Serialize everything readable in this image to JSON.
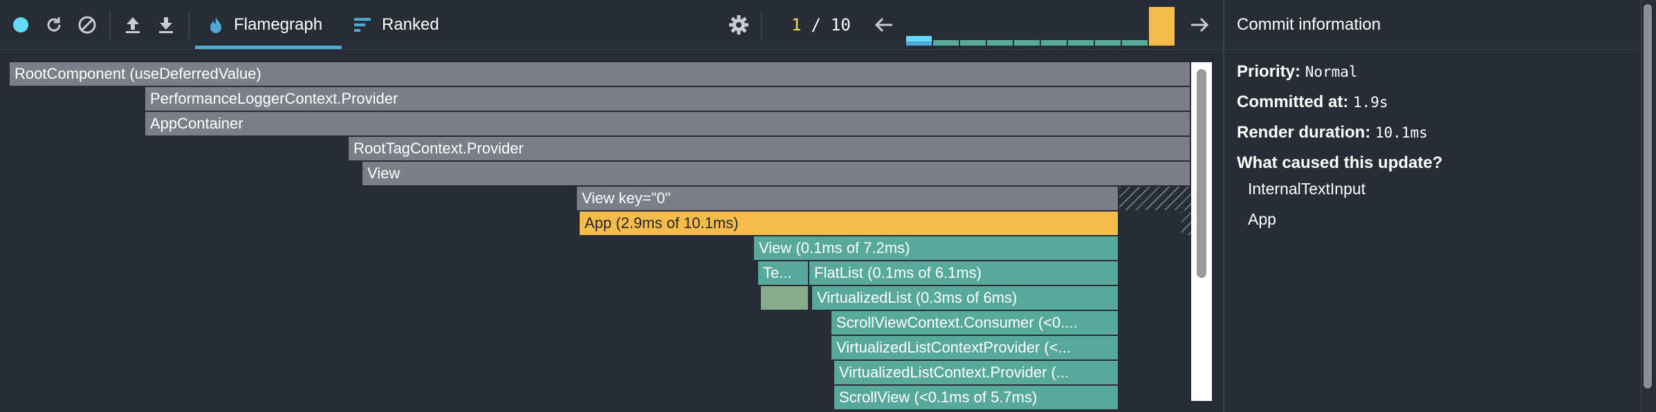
{
  "toolbar": {
    "tabs": [
      {
        "label": "Flamegraph",
        "icon": "flame-icon",
        "active": true
      },
      {
        "label": "Ranked",
        "icon": "ranked-icon",
        "active": false
      }
    ],
    "commit_index": "1",
    "commit_separator": "/",
    "commit_total": "10",
    "commit_bars": [
      {
        "level": 0.08,
        "color": "#61dafb",
        "selected": true
      },
      {
        "level": 0.08,
        "color": "#57a99c"
      },
      {
        "level": 0.08,
        "color": "#57a99c"
      },
      {
        "level": 0.08,
        "color": "#57a99c"
      },
      {
        "level": 0.08,
        "color": "#57a99c"
      },
      {
        "level": 0.08,
        "color": "#57a99c"
      },
      {
        "level": 0.08,
        "color": "#57a99c"
      },
      {
        "level": 0.08,
        "color": "#57a99c"
      },
      {
        "level": 0.08,
        "color": "#57a99c"
      },
      {
        "level": 1.0,
        "color": "#f5bc4c"
      }
    ],
    "record_color": "#61dafb"
  },
  "flamegraph": {
    "nodes": [
      {
        "label": "RootComponent (useDeferredValue)",
        "color": "gray"
      },
      {
        "label": "PerformanceLoggerContext.Provider",
        "color": "gray"
      },
      {
        "label": "AppContainer",
        "color": "gray"
      },
      {
        "label": "RootTagContext.Provider",
        "color": "gray"
      },
      {
        "label": "View",
        "color": "gray"
      },
      {
        "label": "View key=\"0\"",
        "color": "gray"
      },
      {
        "label": "App (2.9ms of 10.1ms)",
        "color": "gold"
      },
      {
        "label": "View (0.1ms of 7.2ms)",
        "color": "teal"
      },
      {
        "label": "Te...",
        "color": "teal"
      },
      {
        "label": "FlatList (0.1ms of 6.1ms)",
        "color": "teal"
      },
      {
        "label": "",
        "color": "sage"
      },
      {
        "label": "VirtualizedList (0.3ms of 6ms)",
        "color": "teal"
      },
      {
        "label": "ScrollViewContext.Consumer (<0....",
        "color": "teal"
      },
      {
        "label": "VirtualizedListContextProvider (<...",
        "color": "teal"
      },
      {
        "label": "VirtualizedListContext.Provider (...",
        "color": "teal"
      },
      {
        "label": "ScrollView (<0.1ms of 5.7ms)",
        "color": "teal"
      }
    ]
  },
  "panel": {
    "title": "Commit information",
    "priority_label": "Priority",
    "priority_value": "Normal",
    "committed_label": "Committed at",
    "committed_value": "1.9s",
    "duration_label": "Render duration",
    "duration_value": "10.1ms",
    "cause_heading": "What caused this update?",
    "causes": [
      "InternalTextInput",
      "App"
    ]
  }
}
